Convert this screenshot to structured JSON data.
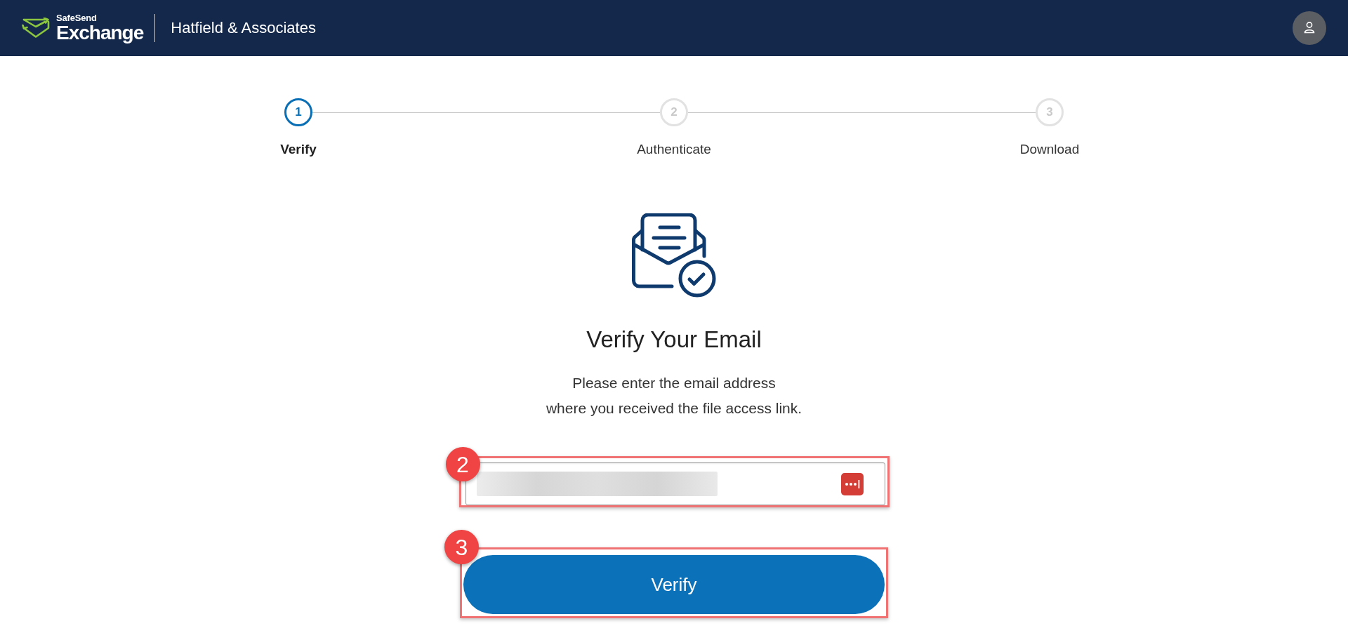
{
  "header": {
    "logo": {
      "line_1": "SafeSend",
      "line_2": "Exchange"
    },
    "company": "Hatfield & Associates"
  },
  "steps": [
    {
      "number": "1",
      "label": "Verify",
      "selected": true
    },
    {
      "number": "2",
      "label": "Authenticate",
      "selected": false
    },
    {
      "number": "3",
      "label": "Download",
      "selected": false
    }
  ],
  "heading": "Verify Your Email",
  "instructions": "Please enter the email address\nwhere you received the file access link.",
  "email_field": {
    "value_redacted": true,
    "callout": "2"
  },
  "verify_button": {
    "label": "Verify",
    "callout": "3"
  }
}
